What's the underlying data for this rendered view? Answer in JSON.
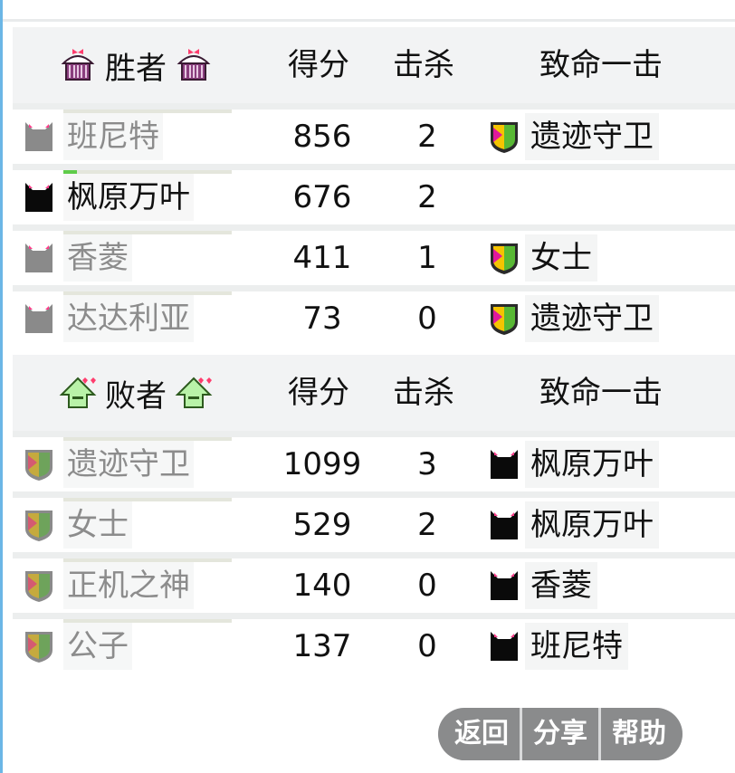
{
  "winners": {
    "title": "胜者",
    "icon": "cupcake-icon",
    "columns": {
      "score": "得分",
      "kills": "击杀",
      "finishing_blow": "致命一击"
    },
    "players": [
      {
        "name": "班尼特",
        "avatar": "gray-cat-avatar",
        "score": "856",
        "kills": "2",
        "killed_by": "遗迹守卫",
        "killed_by_icon": "shield-icon",
        "hp_fraction": 0.0,
        "alive": false
      },
      {
        "name": "枫原万叶",
        "avatar": "black-cat-avatar",
        "score": "676",
        "kills": "2",
        "killed_by": "",
        "killed_by_icon": "",
        "hp_fraction": 0.08,
        "alive": true
      },
      {
        "name": "香菱",
        "avatar": "gray-cat-avatar",
        "score": "411",
        "kills": "1",
        "killed_by": "女士",
        "killed_by_icon": "shield-icon",
        "hp_fraction": 0.0,
        "alive": false
      },
      {
        "name": "达达利亚",
        "avatar": "gray-cat-avatar",
        "score": "73",
        "kills": "0",
        "killed_by": "遗迹守卫",
        "killed_by_icon": "shield-icon",
        "hp_fraction": 0.0,
        "alive": false
      }
    ]
  },
  "losers": {
    "title": "败者",
    "icon": "green-house-icon",
    "columns": {
      "score": "得分",
      "kills": "击杀",
      "finishing_blow": "致命一击"
    },
    "players": [
      {
        "name": "遗迹守卫",
        "avatar": "faded-shield-avatar",
        "score": "1099",
        "kills": "3",
        "killed_by": "枫原万叶",
        "killed_by_icon": "black-cat-icon",
        "hp_fraction": 0.0
      },
      {
        "name": "女士",
        "avatar": "faded-shield-avatar",
        "score": "529",
        "kills": "2",
        "killed_by": "枫原万叶",
        "killed_by_icon": "black-cat-icon",
        "hp_fraction": 0.0
      },
      {
        "name": "正机之神",
        "avatar": "faded-shield-avatar",
        "score": "140",
        "kills": "0",
        "killed_by": "香菱",
        "killed_by_icon": "black-cat-icon",
        "hp_fraction": 0.0
      },
      {
        "name": "公子",
        "avatar": "faded-shield-avatar",
        "score": "137",
        "kills": "0",
        "killed_by": "班尼特",
        "killed_by_icon": "black-cat-icon",
        "hp_fraction": 0.0
      }
    ]
  },
  "buttons": {
    "back": "返回",
    "share": "分享",
    "help": "帮助"
  },
  "colors": {
    "accent_green": "#5fcc4a",
    "button_gray": "#8a8b8c",
    "heart_pink": "#ff3d8a",
    "shield_yellow": "#f5c400",
    "shield_magenta": "#e0189c"
  }
}
